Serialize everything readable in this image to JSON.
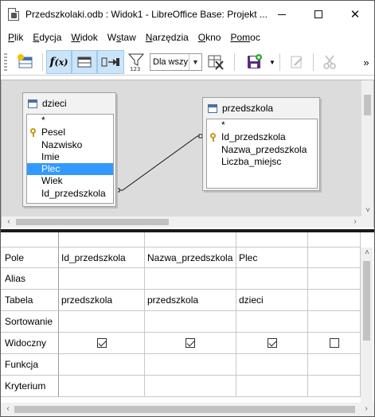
{
  "window": {
    "title": "Przedszkolaki.odb : Widok1 - LibreOffice Base: Projekt ...",
    "minimize_glyph": "",
    "maximize_glyph": "",
    "close_glyph": "✕"
  },
  "menu": [
    {
      "ul": "P",
      "rest": "lik"
    },
    {
      "ul": "E",
      "rest": "dycja"
    },
    {
      "ul": "W",
      "rest": "idok"
    },
    {
      "ul": "W",
      "rest": "staw",
      "ul_pos": 1
    },
    {
      "ul": "N",
      "rest": "arzędzia"
    },
    {
      "ul": "O",
      "rest": "kno"
    },
    {
      "ul": "Pom",
      "rest": "oc"
    }
  ],
  "menu_labels": [
    "Plik",
    "Edycja",
    "Widok",
    "Wstaw",
    "Narzędzia",
    "Okno",
    "Pomoc"
  ],
  "toolbar": {
    "combo_value": "Dla wszy",
    "overflow": "»"
  },
  "tables": [
    {
      "title": "dzieci",
      "fields": [
        {
          "name": "*",
          "key": false,
          "selected": false
        },
        {
          "name": "Pesel",
          "key": true,
          "selected": false
        },
        {
          "name": "Nazwisko",
          "key": false,
          "selected": false
        },
        {
          "name": "Imie",
          "key": false,
          "selected": false
        },
        {
          "name": "Plec",
          "key": false,
          "selected": true
        },
        {
          "name": "Wiek",
          "key": false,
          "selected": false
        },
        {
          "name": "Id_przedszkola",
          "key": false,
          "selected": false
        }
      ]
    },
    {
      "title": "przedszkola",
      "fields": [
        {
          "name": "*",
          "key": false,
          "selected": false
        },
        {
          "name": "Id_przedszkola",
          "key": true,
          "selected": false
        },
        {
          "name": "Nazwa_przedszkola",
          "key": false,
          "selected": false
        },
        {
          "name": "Liczba_miejsc",
          "key": false,
          "selected": false
        }
      ]
    }
  ],
  "grid": {
    "row_labels": [
      "Pole",
      "Alias",
      "Tabela",
      "Sortowanie",
      "Widoczny",
      "Funkcja",
      "Kryterium"
    ],
    "columns": [
      {
        "pole": "Id_przedszkola",
        "tabela": "przedszkola",
        "visible": true
      },
      {
        "pole": "Nazwa_przedszkola",
        "tabela": "przedszkola",
        "visible": true
      },
      {
        "pole": "Plec",
        "tabela": "dzieci",
        "visible": true
      },
      {
        "pole": "",
        "tabela": "",
        "visible": false
      }
    ]
  }
}
